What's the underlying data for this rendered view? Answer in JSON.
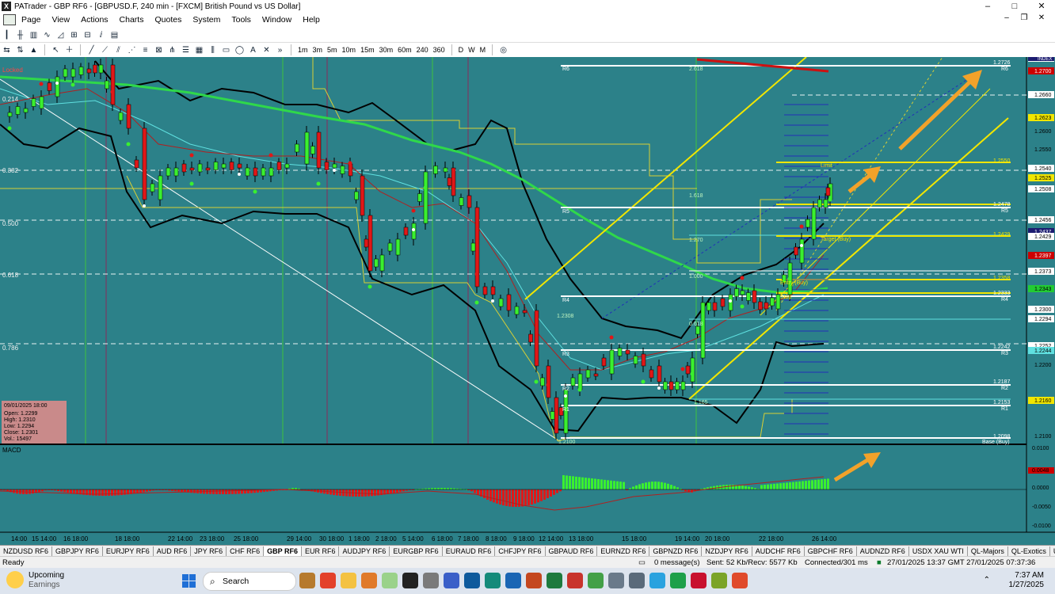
{
  "window": {
    "title": "PATrader - GBP RF6 - [GBPUSD.F, 240 min - [FXCM] British Pound vs US Dollar]",
    "min": "–",
    "max": "□",
    "close": "✕"
  },
  "menu": {
    "items": [
      "Page",
      "View",
      "Actions",
      "Charts",
      "Quotes",
      "System",
      "Tools",
      "Window",
      "Help"
    ]
  },
  "toolbar2": {
    "timeframes": [
      "1m",
      "3m",
      "5m",
      "10m",
      "15m",
      "30m",
      "60m",
      "240",
      "360",
      "D",
      "W",
      "M"
    ]
  },
  "chart": {
    "fib_labels": [
      "0.382",
      "0.500",
      "0.618",
      "0.786"
    ],
    "left_label_top": "0.214",
    "locked": "Locked",
    "pivot_labels": [
      {
        "name": "R6",
        "price": "1.2726"
      },
      {
        "name": "R5",
        "price": "1.2478"
      },
      {
        "name": "R4",
        "price": "1.2333"
      },
      {
        "name": "R3",
        "price": "1.2242"
      },
      {
        "name": "R2",
        "price": "1.2187"
      },
      {
        "name": "R1",
        "price": "1.2153"
      },
      {
        "name": "Base (Buy)",
        "price": "1.2098"
      }
    ],
    "mid_labels": {
      "l1618": "1.618",
      "l1270": "1.270",
      "l2618": "2.618",
      "l1000": "1.000",
      "l0618": "0.618",
      "l2308": "1.2308",
      "l1165": "1.165",
      "l2100": "1.2100",
      "limit": "Limit",
      "target_buy": "Target (Buy)",
      "entry_buy": "Entry (Buy)",
      "stop": "Stop",
      "hist_y": "1.2550",
      "hist_y2": "1.2429",
      "hist_y3": "1.2358"
    },
    "price_axis": {
      "index": "INDEX",
      "ticks": [
        {
          "v": "1.2710",
          "c": "#ffffff",
          "fg": "#000"
        },
        {
          "v": "1.2700",
          "c": "#cc0000",
          "fg": "#fff"
        },
        {
          "v": "1.2660",
          "c": "#ffffff",
          "fg": "#000"
        },
        {
          "v": "1.2623",
          "c": "#f2e600",
          "fg": "#000"
        },
        {
          "v": "1.2600",
          "c": "#2c8189",
          "fg": "#000"
        },
        {
          "v": "1.2550",
          "c": "#2c8189",
          "fg": "#000"
        },
        {
          "v": "1.2540",
          "c": "#ffffff",
          "fg": "#000"
        },
        {
          "v": "1.2525",
          "c": "#f2e600",
          "fg": "#000"
        },
        {
          "v": "1.2508",
          "c": "#ffffff",
          "fg": "#000"
        },
        {
          "v": "1.2456",
          "c": "#ffffff",
          "fg": "#000"
        },
        {
          "v": "1.2437",
          "c": "#1b1b70",
          "fg": "#fff"
        },
        {
          "v": "1.2429",
          "c": "#ffffff",
          "fg": "#000"
        },
        {
          "v": "1.2397",
          "c": "#cc0000",
          "fg": "#fff"
        },
        {
          "v": "1.2373",
          "c": "#ffffff",
          "fg": "#000"
        },
        {
          "v": "1.2343",
          "c": "#22cc33",
          "fg": "#000"
        },
        {
          "v": "1.2300",
          "c": "#ffffff",
          "fg": "#000"
        },
        {
          "v": "1.2294",
          "c": "#ffffff",
          "fg": "#000"
        },
        {
          "v": "1.2252",
          "c": "#ffffff",
          "fg": "#000"
        },
        {
          "v": "1.2244",
          "c": "#5fe0e0",
          "fg": "#000"
        },
        {
          "v": "1.2200",
          "c": "#2c8189",
          "fg": "#000"
        },
        {
          "v": "1.2160",
          "c": "#f2e600",
          "fg": "#000"
        },
        {
          "v": "1.2100",
          "c": "#2c8189",
          "fg": "#000"
        }
      ]
    },
    "macd": {
      "label": "MACD",
      "ticks": [
        "0.0100",
        "0.0048",
        "0.0000",
        "-0.0050",
        "-0.0100"
      ]
    },
    "time_labels": [
      "14:00",
      "15 14:00",
      "16 18:00",
      "18 18:00",
      "22 14:00",
      "23 18:00",
      "25 18:00",
      "29 14:00",
      "30 18:00",
      "1 18:00",
      "2 18:00",
      "5 14:00",
      "6 18:00",
      "7 18:00",
      "8 18:00",
      "9 18:00",
      "12 14:00",
      "13 18:00",
      "15 18:00",
      "19 14:00",
      "20 18:00",
      "22 18:00",
      "26 14:00"
    ],
    "ohlc": {
      "date": "09/01/2025 18:00",
      "open": "Open: 1.2299",
      "high": "High: 1.2310",
      "low": "Low: 1.2294",
      "close": "Close: 1.2301",
      "vol": "Vol.: 15497"
    }
  },
  "tabs": [
    "NZDUSD RF6",
    "GBPJPY RF6",
    "EURJPY RF6",
    "AUD RF6",
    "JPY RF6",
    "CHF RF6",
    "GBP RF6",
    "EUR RF6",
    "AUDJPY RF6",
    "EURGBP RF6",
    "EURAUD RF6",
    "CHFJPY RF6",
    "GBPAUD RF6",
    "EURNZD RF6",
    "GBPNZD RF6",
    "NZDJPY RF6",
    "AUDCHF RF6",
    "GBPCHF RF6",
    "AUDNZD RF6",
    "USDX XAU WTI",
    "QL-Majors",
    "QL-Exotics",
    "USDX RF6",
    "Bitcoin",
    "SP500 RF6",
    "DJIA"
  ],
  "active_tab": "GBP RF6",
  "status": {
    "ready": "Ready",
    "messages": "0 message(s)",
    "traffic": "Sent: 52 Kb/Recv: 5577 Kb",
    "connected": "Connected/301 ms",
    "time": "27/01/2025 13:37 GMT  27/01/2025 07:37:36 Local"
  },
  "taskbar": {
    "weather_title": "Upcoming",
    "weather_sub": "Earnings",
    "search": "Search",
    "clock_time": "7:37 AM",
    "clock_date": "1/27/2025"
  }
}
